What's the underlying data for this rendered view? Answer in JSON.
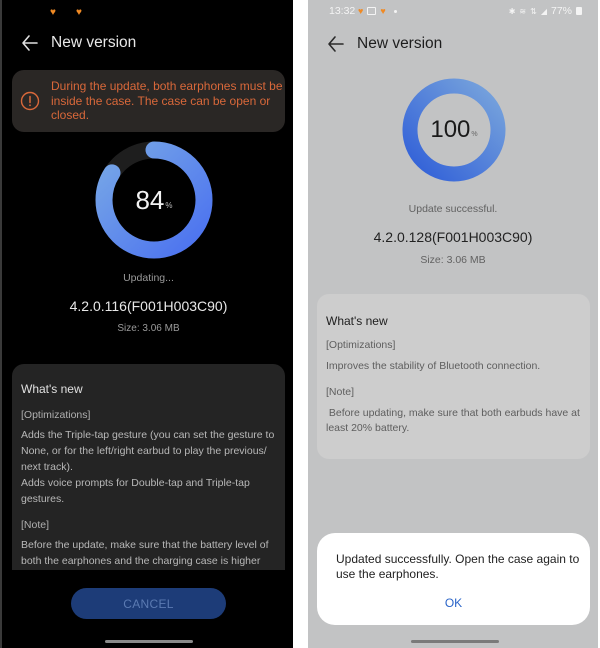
{
  "left_screen": {
    "status_bar": {
      "icons": [
        "app-notification-icon",
        "app-notification-icon"
      ]
    },
    "header": {
      "back_icon": "arrow-left-icon",
      "title": "New version"
    },
    "warning": {
      "icon": "exclamation-circle-icon",
      "text": "During the update, both earphones must be inside the case. The case can be open or closed.",
      "color": "#d9683a"
    },
    "progress": {
      "percent_value": 84,
      "value_label": "84",
      "unit": "%",
      "color_start": "#4a70f0",
      "color_end": "#78a8e6",
      "track_color": "#1e1e1e"
    },
    "status_text": "Updating...",
    "version": "4.2.0.116(F001H003C90)",
    "size": "Size: 3.06 MB",
    "whats_new": {
      "title": "What's new",
      "sections": [
        {
          "heading": "[Optimizations]",
          "lines": [
            "Adds the Triple-tap gesture (you can set the gesture to None, or for the left/right earbud to play the previous/ next track).",
            "Adds voice prompts for Double-tap and Triple-tap gestures."
          ]
        },
        {
          "heading": "[Note]",
          "lines": [
            "Before the update, make sure that the battery level of both the earphones and the charging case is higher"
          ]
        }
      ]
    },
    "cancel_label": "CANCEL"
  },
  "right_screen": {
    "status_bar": {
      "time": "13:32",
      "left_icons": [
        "app-notification-icon",
        "image-icon",
        "app-notification-icon",
        "dot-icon"
      ],
      "right_icons": [
        "bluetooth-icon",
        "wifi-icon",
        "data-icon",
        "signal-icon"
      ],
      "battery": "77%"
    },
    "header": {
      "back_icon": "arrow-left-icon",
      "title": "New version"
    },
    "progress": {
      "percent_value": 100,
      "value_label": "100",
      "unit": "%",
      "color_start": "#2f5ed8",
      "color_end": "#7aa6dc"
    },
    "status_text": "Update successful.",
    "version": "4.2.0.128(F001H003C90)",
    "size": "Size: 3.06 MB",
    "whats_new": {
      "title": "What's new",
      "sections": [
        {
          "heading": "[Optimizations]",
          "lines": [
            "Improves the stability of Bluetooth connection."
          ]
        },
        {
          "heading": "[Note]",
          "lines": [
            " Before updating, make sure that both earbuds have at least 20% battery."
          ]
        }
      ]
    },
    "dialog": {
      "message": "Updated successfully. Open the case again to use the earphones.",
      "ok_label": "OK",
      "ok_color": "#2a64c8"
    }
  }
}
